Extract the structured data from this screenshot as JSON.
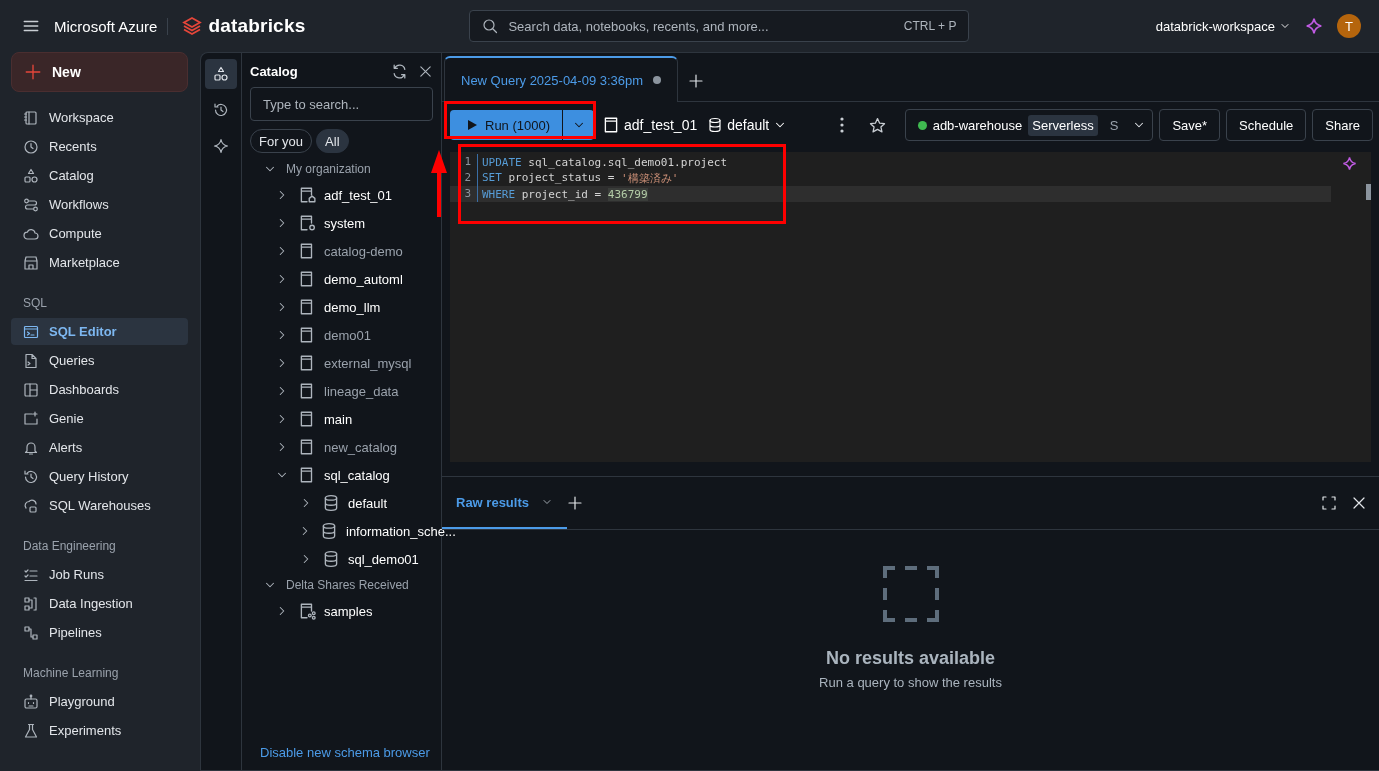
{
  "topbar": {
    "brand": "Microsoft Azure",
    "product": "databricks",
    "search": {
      "placeholder": "Search data, notebooks, recents, and more..."
    },
    "shortcut": "CTRL + P",
    "workspace": "databrick-workspace",
    "avatar": "T"
  },
  "sidebar": {
    "new_label": "New",
    "sections": [
      {
        "items": [
          {
            "label": "Workspace",
            "selected": false
          },
          {
            "label": "Recents",
            "selected": false
          },
          {
            "label": "Catalog",
            "selected": false
          },
          {
            "label": "Workflows",
            "selected": false
          },
          {
            "label": "Compute",
            "selected": false
          },
          {
            "label": "Marketplace",
            "selected": false
          }
        ]
      },
      {
        "title": "SQL",
        "items": [
          {
            "label": "SQL Editor",
            "selected": true
          },
          {
            "label": "Queries",
            "selected": false
          },
          {
            "label": "Dashboards",
            "selected": false
          },
          {
            "label": "Genie",
            "selected": false
          },
          {
            "label": "Alerts",
            "selected": false
          },
          {
            "label": "Query History",
            "selected": false
          },
          {
            "label": "SQL Warehouses",
            "selected": false
          }
        ]
      },
      {
        "title": "Data Engineering",
        "items": [
          {
            "label": "Job Runs",
            "selected": false
          },
          {
            "label": "Data Ingestion",
            "selected": false
          },
          {
            "label": "Pipelines",
            "selected": false
          }
        ]
      },
      {
        "title": "Machine Learning",
        "items": [
          {
            "label": "Playground",
            "selected": false
          },
          {
            "label": "Experiments",
            "selected": false
          }
        ]
      }
    ]
  },
  "rail": [
    {
      "selected": true
    },
    {
      "selected": false
    },
    {
      "selected": false
    }
  ],
  "catalog": {
    "title": "Catalog",
    "search": {
      "placeholder": "Type to search..."
    },
    "filters": [
      {
        "label": "For you",
        "selected": false
      },
      {
        "label": "All",
        "selected": true
      }
    ],
    "tree": [
      {
        "kind": "group",
        "label": "My organization",
        "expanded": true,
        "children": [
          {
            "kind": "workspace",
            "label": "adf_test_01",
            "muted": false,
            "expanded": false
          },
          {
            "kind": "system",
            "label": "system",
            "muted": false,
            "expanded": false
          },
          {
            "kind": "catalog",
            "label": "catalog-demo",
            "muted": true,
            "expanded": false
          },
          {
            "kind": "catalog",
            "label": "demo_automl",
            "muted": false,
            "expanded": false
          },
          {
            "kind": "catalog",
            "label": "demo_llm",
            "muted": false,
            "expanded": false
          },
          {
            "kind": "catalog",
            "label": "demo01",
            "muted": true,
            "expanded": false
          },
          {
            "kind": "catalog",
            "label": "external_mysql",
            "muted": true,
            "expanded": false
          },
          {
            "kind": "catalog",
            "label": "lineage_data",
            "muted": true,
            "expanded": false
          },
          {
            "kind": "catalog",
            "label": "main",
            "muted": false,
            "expanded": false
          },
          {
            "kind": "catalog",
            "label": "new_catalog",
            "muted": true,
            "expanded": false
          },
          {
            "kind": "catalog",
            "label": "sql_catalog",
            "muted": false,
            "expanded": true,
            "children": [
              {
                "kind": "schema",
                "label": "default",
                "muted": false,
                "expanded": false
              },
              {
                "kind": "schema",
                "label": "information_sche...",
                "muted": false,
                "expanded": false
              },
              {
                "kind": "schema",
                "label": "sql_demo01",
                "muted": false,
                "expanded": false
              }
            ]
          }
        ]
      },
      {
        "kind": "group",
        "label": "Delta Shares Received",
        "expanded": true,
        "children": [
          {
            "kind": "share",
            "label": "samples",
            "muted": false,
            "expanded": false
          }
        ]
      }
    ],
    "footer_link": "Disable new schema browser"
  },
  "editor": {
    "tab": {
      "title": "New Query 2025-04-09 3:36pm",
      "unsaved": true
    },
    "run_label": "Run (1000)",
    "catalog": "adf_test_01",
    "schema": "default",
    "warehouse": {
      "name": "adb-warehouse",
      "running": true,
      "type": "Serverless",
      "size": "S"
    },
    "buttons": [
      "Save*",
      "Schedule",
      "Share"
    ],
    "lines": [
      {
        "number": "1",
        "current": false,
        "tokens": [
          {
            "kind": "keyword",
            "text": "UPDATE"
          },
          {
            "kind": "plain",
            "text": " sql_catalog.sql_demo01.project"
          }
        ]
      },
      {
        "number": "2",
        "current": false,
        "tokens": [
          {
            "kind": "keyword",
            "text": "SET"
          },
          {
            "kind": "plain",
            "text": " project_status"
          },
          {
            "kind": "op",
            "text": " = "
          },
          {
            "kind": "string",
            "text": "'構築済み'"
          }
        ]
      },
      {
        "number": "3",
        "current": true,
        "tokens": [
          {
            "kind": "keyword",
            "text": "WHERE"
          },
          {
            "kind": "plain",
            "text": " project_id"
          },
          {
            "kind": "op",
            "text": " = "
          },
          {
            "kind": "number",
            "text": "436799"
          }
        ]
      }
    ]
  },
  "results": {
    "tab": "Raw results",
    "empty_title": "No results available",
    "empty_text": "Run a query to show the results"
  }
}
